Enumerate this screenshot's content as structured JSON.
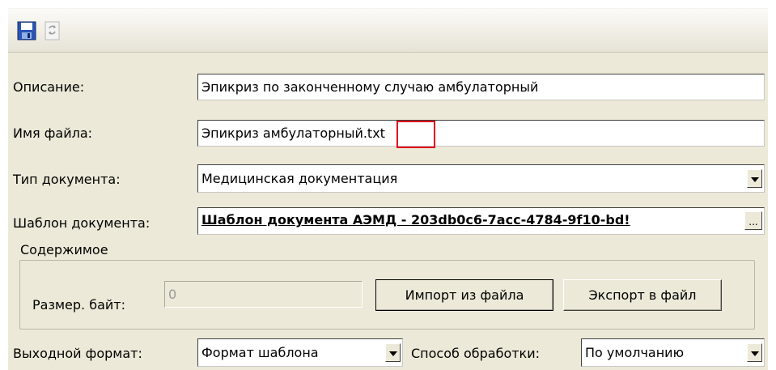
{
  "toolbar": {
    "save_icon": "floppy-disk-icon",
    "refresh_icon": "refresh-icon"
  },
  "form": {
    "description_label": "Описание:",
    "description_value": "Эпикриз по законченному случаю амбулаторный",
    "filename_label": "Имя файла:",
    "filename_value": "Эпикриз амбулаторный.txt",
    "doctype_label": "Тип документа:",
    "doctype_value": "Медицинская документация",
    "template_label": "Шаблон документа:",
    "template_value": "Шаблон документа АЭМД - 203db0c6-7acc-4784-9f10-bd!",
    "template_button": "..."
  },
  "content_group": {
    "title": "Содержимое",
    "size_label": "Размер. байт:",
    "size_value": "0",
    "import_button": "Импорт из файла",
    "export_button": "Экспорт в файл"
  },
  "output": {
    "format_label": "Выходной формат:",
    "format_value": "Формат шаблона",
    "processing_label": "Способ обработки:",
    "processing_value": "По умолчанию"
  },
  "colors": {
    "window_bg": "#ece9d8",
    "highlight_border": "#e0001a"
  }
}
